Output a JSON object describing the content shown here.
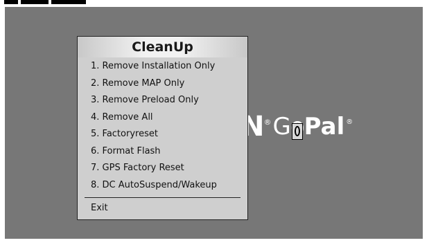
{
  "background": {
    "screen_color": "#777777",
    "frame_color": "#ffffff"
  },
  "logo": {
    "mark": "N",
    "registered": "®",
    "go": "Go",
    "pal": "Pal",
    "registered2": "®"
  },
  "dialog": {
    "title": "CleanUp",
    "items": [
      {
        "label": "1. Remove Installation Only"
      },
      {
        "label": "2. Remove MAP Only"
      },
      {
        "label": "3. Remove Preload Only"
      },
      {
        "label": "4. Remove All"
      },
      {
        "label": "5. Factoryreset"
      },
      {
        "label": "6. Format Flash"
      },
      {
        "label": "7. GPS Factory Reset"
      },
      {
        "label": "8. DC AutoSuspend/Wakeup"
      }
    ],
    "exit_label": "Exit"
  },
  "icons": {
    "text_cursor": "text-cursor-icon"
  }
}
